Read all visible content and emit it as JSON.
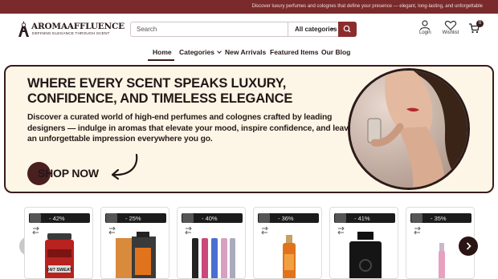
{
  "topbar": {
    "text": "Discover luxury perfumes and colognes that define your presence — elegant, long-lasting, and unforgettable"
  },
  "brand": {
    "name": "AROMAAFFLUENCE",
    "tagline": "DEFINING ELEGANCE THROUGH SCENT",
    "color": "#7a2a2a"
  },
  "search": {
    "placeholder": "Search",
    "category": "All categories"
  },
  "header_icons": {
    "login": "Login",
    "wishlist": "Wishlist",
    "cart_count": "0"
  },
  "nav": {
    "items": [
      "Home",
      "Categories",
      "New Arrivals",
      "Featured Items",
      "Our Blog"
    ]
  },
  "hero": {
    "title": "WHERE EVERY SCENT SPEAKS LUXURY, CONFIDENCE, AND TIMELESS ELEGANCE",
    "description": "Discover a curated world of high-end perfumes and colognes crafted by leading designers — indulge in aromas that elevate your mood, inspire confidence, and leave an unforgettable impression everywhere you go.",
    "cta": "SHOP NOW"
  },
  "products": [
    {
      "discount": "- 42%",
      "label": "24/7 SWEAT"
    },
    {
      "discount": "- 25%"
    },
    {
      "discount": "- 40%"
    },
    {
      "discount": "- 36%"
    },
    {
      "discount": "- 41%"
    },
    {
      "discount": "- 35%"
    }
  ]
}
